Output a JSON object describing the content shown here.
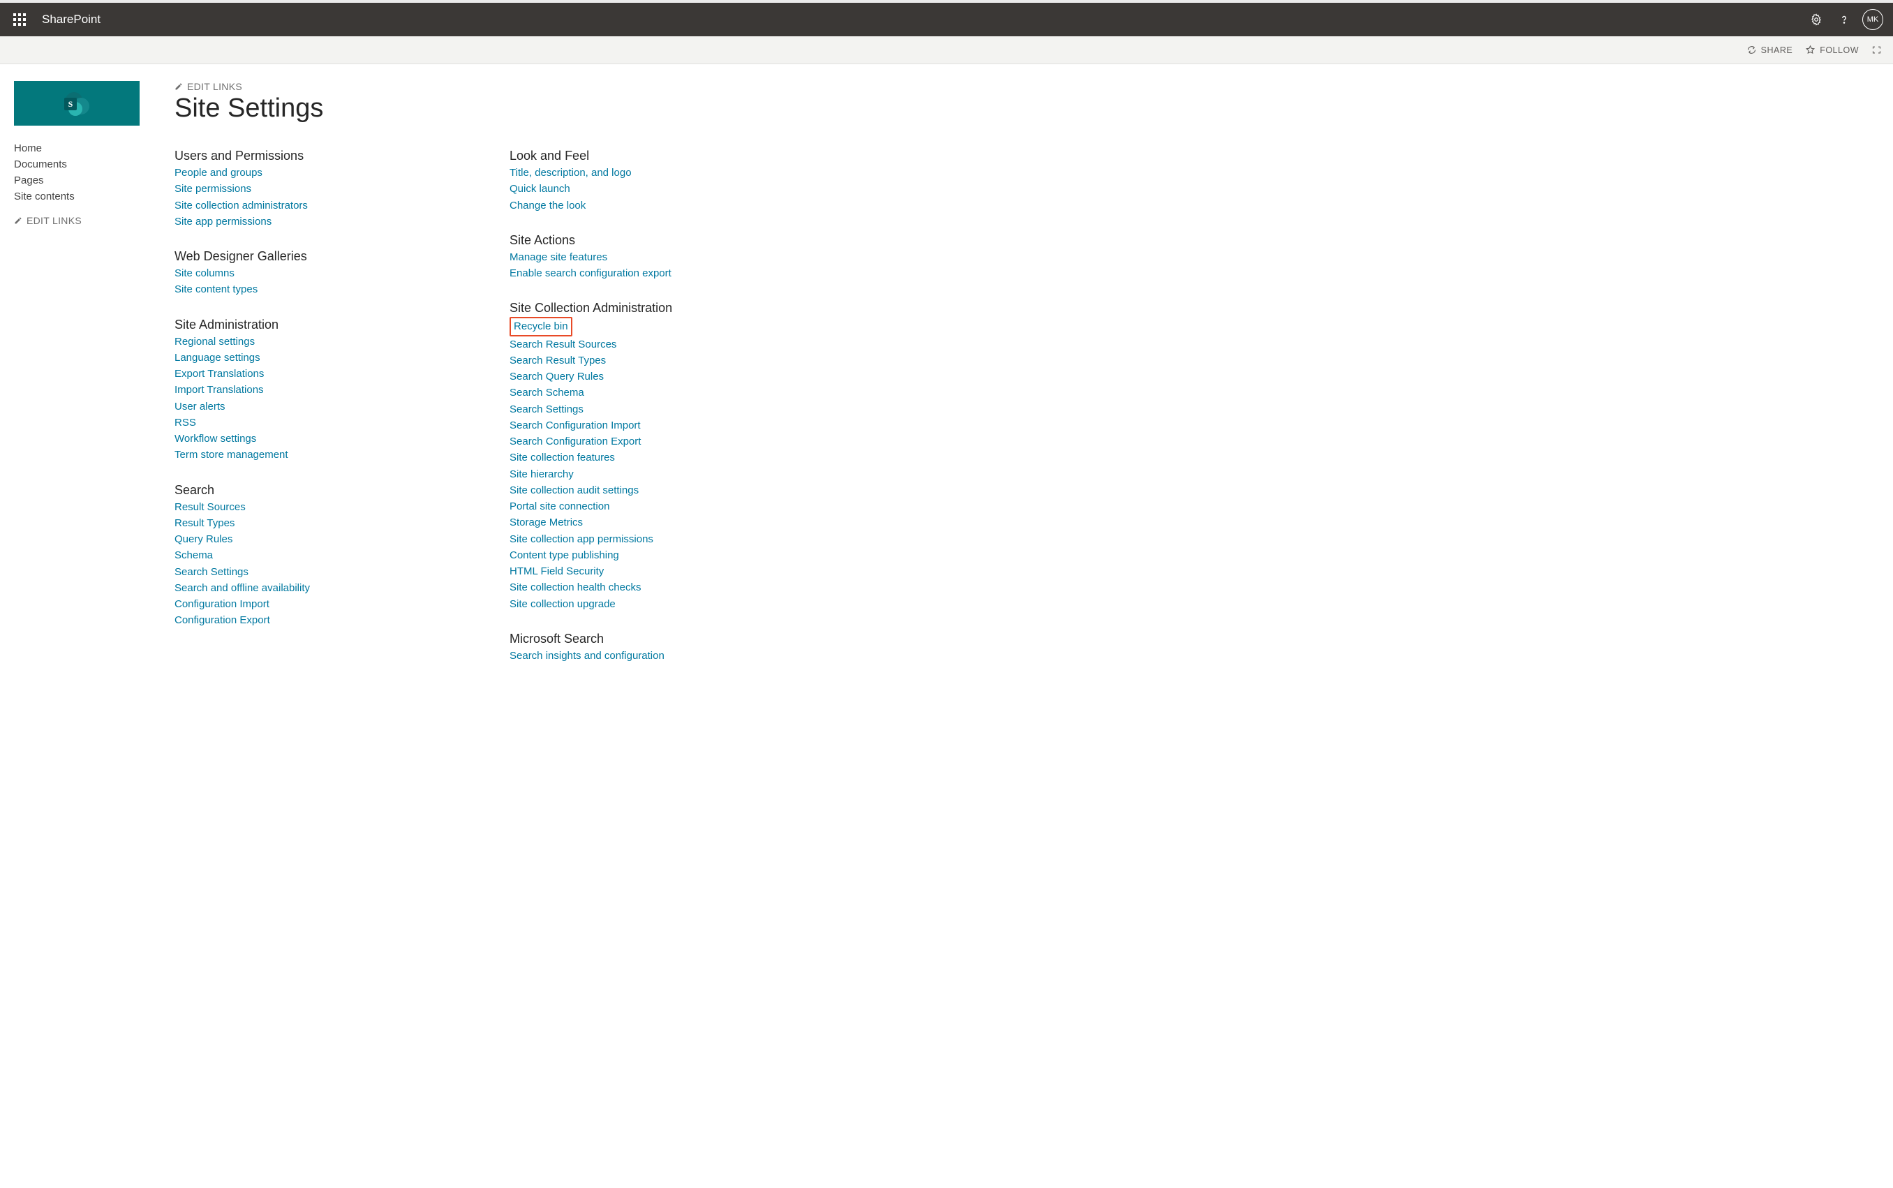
{
  "suite": {
    "app_name": "SharePoint",
    "avatar_initials": "MK"
  },
  "ribbon": {
    "share": "SHARE",
    "follow": "FOLLOW"
  },
  "nav": {
    "items": [
      "Home",
      "Documents",
      "Pages",
      "Site contents"
    ],
    "edit_links_label": "EDIT LINKS"
  },
  "page": {
    "edit_links_label": "EDIT LINKS",
    "title": "Site Settings"
  },
  "columns": [
    {
      "sections": [
        {
          "heading": "Users and Permissions",
          "links": [
            "People and groups",
            "Site permissions",
            "Site collection administrators",
            "Site app permissions"
          ]
        },
        {
          "heading": "Web Designer Galleries",
          "links": [
            "Site columns",
            "Site content types"
          ]
        },
        {
          "heading": "Site Administration",
          "links": [
            "Regional settings",
            "Language settings",
            "Export Translations",
            "Import Translations",
            "User alerts",
            "RSS",
            "Workflow settings",
            "Term store management"
          ]
        },
        {
          "heading": "Search",
          "links": [
            "Result Sources",
            "Result Types",
            "Query Rules",
            "Schema",
            "Search Settings",
            "Search and offline availability",
            "Configuration Import",
            "Configuration Export"
          ]
        }
      ]
    },
    {
      "sections": [
        {
          "heading": "Look and Feel",
          "links": [
            "Title, description, and logo",
            "Quick launch",
            "Change the look"
          ]
        },
        {
          "heading": "Site Actions",
          "links": [
            "Manage site features",
            "Enable search configuration export"
          ]
        },
        {
          "heading": "Site Collection Administration",
          "highlight_index": 0,
          "links": [
            "Recycle bin",
            "Search Result Sources",
            "Search Result Types",
            "Search Query Rules",
            "Search Schema",
            "Search Settings",
            "Search Configuration Import",
            "Search Configuration Export",
            "Site collection features",
            "Site hierarchy",
            "Site collection audit settings",
            "Portal site connection",
            "Storage Metrics",
            "Site collection app permissions",
            "Content type publishing",
            "HTML Field Security",
            "Site collection health checks",
            "Site collection upgrade"
          ]
        },
        {
          "heading": "Microsoft Search",
          "links": [
            "Search insights and configuration"
          ]
        }
      ]
    }
  ]
}
